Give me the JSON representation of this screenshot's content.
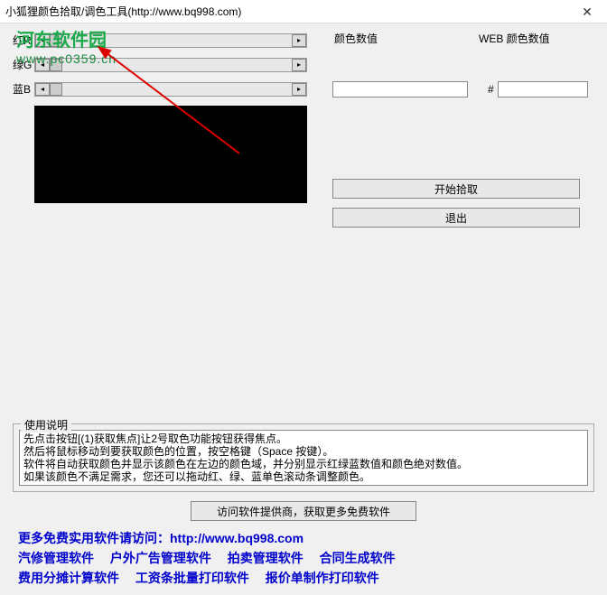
{
  "window": {
    "title": "小狐狸颜色拾取/调色工具(http://www.bq998.com)"
  },
  "sliders": {
    "r": "红R",
    "g": "绿G",
    "b": "蓝B"
  },
  "labels": {
    "colorValue": "颜色数值",
    "webValue": "WEB 颜色数值",
    "hash": "#"
  },
  "buttons": {
    "pick": "开始拾取",
    "exit": "退出",
    "visit": "访问软件提供商，获取更多免费软件"
  },
  "help": {
    "legend": "使用说明",
    "line1": "先点击按钮[(1)获取焦点]让2号取色功能按钮获得焦点。",
    "line2": "然后将鼠标移动到要获取颜色的位置，按空格键（Space 按键）。",
    "line3": "软件将自动获取颜色并显示该颜色在左边的颜色域，并分别显示红绿蓝数值和颜色绝对数值。",
    "line4": "如果该颜色不满足需求，您还可以拖动红、绿、蓝单色滚动条调整颜色。"
  },
  "links": {
    "intro": "更多免费实用软件请访问：",
    "url": "http://www.bq998.com",
    "row2a": "汽修管理软件",
    "row2b": "户外广告管理软件",
    "row2c": "拍卖管理软件",
    "row2d": "合同生成软件",
    "row3a": "费用分摊计算软件",
    "row3b": "工资条批量打印软件",
    "row3c": "报价单制作打印软件"
  },
  "watermark": {
    "top": "河东软件园",
    "bottom": "www.pc0359.cn"
  }
}
